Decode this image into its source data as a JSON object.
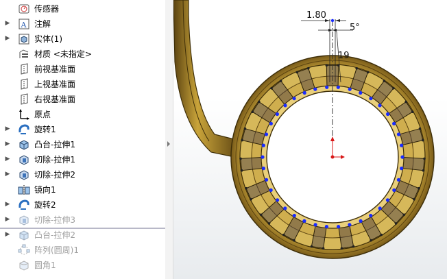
{
  "feature_tree": {
    "items": [
      {
        "label": "传感器",
        "icon": "sensor-icon",
        "expandable": false,
        "dim": false
      },
      {
        "label": "注解",
        "icon": "annotation-icon",
        "expandable": true,
        "dim": false
      },
      {
        "label": "实体(1)",
        "icon": "solid-bodies-icon",
        "expandable": true,
        "dim": false
      },
      {
        "label": "材质 <未指定>",
        "icon": "material-icon",
        "expandable": false,
        "dim": false
      },
      {
        "label": "前视基准面",
        "icon": "plane-icon",
        "expandable": false,
        "dim": false
      },
      {
        "label": "上视基准面",
        "icon": "plane-icon",
        "expandable": false,
        "dim": false
      },
      {
        "label": "右视基准面",
        "icon": "plane-icon",
        "expandable": false,
        "dim": false
      },
      {
        "label": "原点",
        "icon": "origin-icon",
        "expandable": false,
        "dim": false
      },
      {
        "label": "旋转1",
        "icon": "revolve-icon",
        "expandable": true,
        "dim": false
      },
      {
        "label": "凸台-拉伸1",
        "icon": "boss-extrude-icon",
        "expandable": true,
        "dim": false
      },
      {
        "label": "切除-拉伸1",
        "icon": "cut-extrude-icon",
        "expandable": true,
        "dim": false
      },
      {
        "label": "切除-拉伸2",
        "icon": "cut-extrude-icon",
        "expandable": true,
        "dim": false
      },
      {
        "label": "镜向1",
        "icon": "mirror-icon",
        "expandable": false,
        "dim": false
      },
      {
        "label": "旋转2",
        "icon": "revolve-icon",
        "expandable": true,
        "dim": false
      },
      {
        "label": "切除-拉伸3",
        "icon": "cut-extrude-icon",
        "expandable": true,
        "dim": true
      },
      {
        "label": "凸台-拉伸2",
        "icon": "boss-extrude-icon",
        "expandable": true,
        "dim": true
      },
      {
        "label": "阵列(圆周)1",
        "icon": "circular-pattern-icon",
        "expandable": false,
        "dim": true
      },
      {
        "label": "圆角1",
        "icon": "fillet-icon",
        "expandable": false,
        "dim": true
      }
    ]
  },
  "viewport": {
    "dimension_width": "1.80",
    "dimension_angle": "5°",
    "tooth_count_label": "19",
    "colors": {
      "gold": "#c9a43a",
      "gold_dark": "#6e5318",
      "gold_light": "#e8cf76",
      "point": "#1a2cff",
      "origin": "#d81818"
    }
  }
}
